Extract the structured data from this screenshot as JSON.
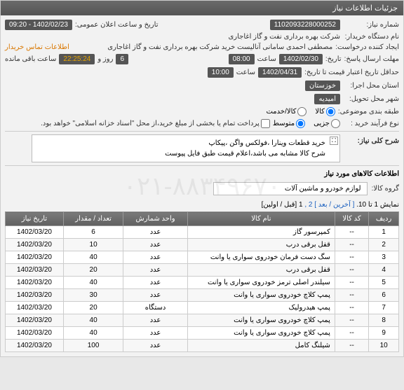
{
  "panel_title": "جزئیات اطلاعات نیاز",
  "form": {
    "need_number": {
      "label": "شماره نیاز:",
      "value": "1102093228000252"
    },
    "announce": {
      "label": "تاریخ و ساعت اعلان عمومی:",
      "value": "1402/02/23 - 09:20"
    },
    "buyer_org": {
      "label": "نام دستگاه خریدار:",
      "value": "شرکت بهره برداری نفت و گاز اغاجاری"
    },
    "request_creator": {
      "label": "ایجاد کننده درخواست:",
      "value": "مصطفی احمدی سامانی آنالیست خرید شرکت بهره برداری نفت و گاز اغاجاری"
    },
    "buyer_contact": "اطلاعات تماس خریدار",
    "deadline": {
      "label": "مهلت ارسال پاسخ:",
      "date_label": "تاریخ:",
      "date": "1402/02/30",
      "time_label": "ساعت",
      "time": "08:00",
      "day_label": "روز و",
      "days": "6",
      "remain_label": "ساعت باقی مانده",
      "remain": "22:25:24"
    },
    "valid_until": {
      "label": "حداقل تاریخ اعتبار قیمت تا تاریخ:",
      "date": "1402/04/31",
      "time_label": "ساعت",
      "time": "10:00"
    },
    "exec_province": {
      "label": "استان محل اجرا:",
      "value": "خوزستان"
    },
    "exec_city": {
      "label": "شهر محل تحویل:",
      "value": "امیدیه"
    },
    "subject_class": {
      "label": "طبقه بندی موضوعی:",
      "kala_label": "کالا",
      "khadmat_label": "کالا/خدمت"
    },
    "purchase_type": {
      "label": "نوع فرآیند خرید :",
      "small": "جزیی",
      "medium": "متوسط",
      "note": "پرداخت تمام یا بخشی از مبلغ خرید،از محل \"اسناد خزانه اسلامی\" خواهد بود."
    }
  },
  "description": {
    "label": "شرح کلی نیاز:",
    "line1": "خرید قطعات وینارا ،فولکس واگن ،پیکاپ",
    "line2": "شرح کالا مشابه می باشد،اعلام قیمت طبق فایل پیوست"
  },
  "goods_section": {
    "title": "اطلاعات کالاهای مورد نیاز",
    "group_label": "گروه کالا:",
    "group_value": "لوازم خودرو و ماشین آلات"
  },
  "pagination": {
    "text1": "نمایش 1 تا 10.",
    "last": "[ آخرین",
    "next": "/ بعد ]",
    "pages": "2 ,",
    "current": "1",
    "first": "[قبل / اولین]"
  },
  "table": {
    "headers": {
      "row": "ردیف",
      "code": "کد کالا",
      "name": "نام کالا",
      "unit": "واحد شمارش",
      "qty": "تعداد / مقدار",
      "date": "تاریخ نیاز"
    },
    "rows": [
      {
        "idx": "1",
        "code": "--",
        "name": "کمپرسور گاز",
        "unit": "عدد",
        "qty": "6",
        "date": "1402/03/20"
      },
      {
        "idx": "2",
        "code": "--",
        "name": "قفل برقی درب",
        "unit": "عدد",
        "qty": "10",
        "date": "1402/03/20"
      },
      {
        "idx": "3",
        "code": "--",
        "name": "سگ دست فرمان خودروی سواری یا وانت",
        "unit": "عدد",
        "qty": "40",
        "date": "1402/03/20"
      },
      {
        "idx": "4",
        "code": "--",
        "name": "قفل برقی درب",
        "unit": "عدد",
        "qty": "20",
        "date": "1402/03/20"
      },
      {
        "idx": "5",
        "code": "--",
        "name": "سیلندر اصلی ترمز خودروی سواری یا وانت",
        "unit": "عدد",
        "qty": "40",
        "date": "1402/03/20"
      },
      {
        "idx": "6",
        "code": "--",
        "name": "پمپ کلاچ خودروی سواری یا وانت",
        "unit": "عدد",
        "qty": "30",
        "date": "1402/03/20"
      },
      {
        "idx": "7",
        "code": "--",
        "name": "پمپ هیدرولیک",
        "unit": "دستگاه",
        "qty": "20",
        "date": "1402/03/20"
      },
      {
        "idx": "8",
        "code": "--",
        "name": "پمپ کلاچ خودروی سواری یا وانت",
        "unit": "عدد",
        "qty": "40",
        "date": "1402/03/20"
      },
      {
        "idx": "9",
        "code": "--",
        "name": "پمپ کلاچ خودروی سواری یا وانت",
        "unit": "عدد",
        "qty": "40",
        "date": "1402/03/20"
      },
      {
        "idx": "10",
        "code": "--",
        "name": "شیلنگ کامل",
        "unit": "عدد",
        "qty": "100",
        "date": "1402/03/20"
      }
    ]
  },
  "watermark": "۰۲۱-۸۸۳۴۹۶۷۰"
}
